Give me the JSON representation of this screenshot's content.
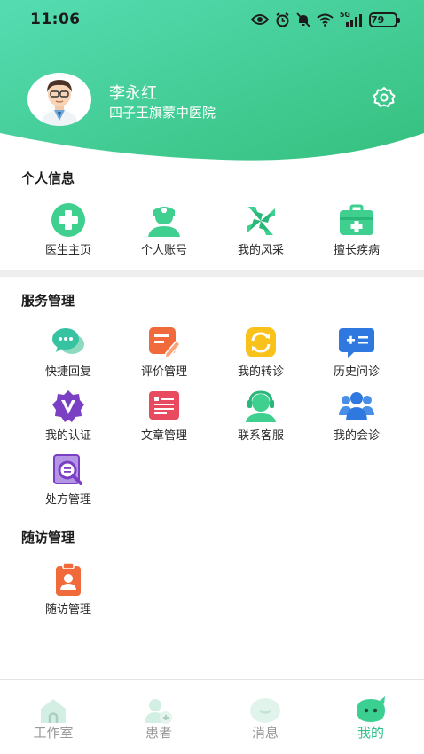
{
  "status_bar": {
    "time": "11:06",
    "battery": "79",
    "network": "5G"
  },
  "profile": {
    "name": "李永红",
    "hospital": "四子王旗蒙中医院",
    "settings_icon": "gear-icon"
  },
  "personal_info": {
    "title": "个人信息",
    "items": [
      {
        "label": "医生主页",
        "icon": "medical-cross-icon"
      },
      {
        "label": "个人账号",
        "icon": "nurse-icon"
      },
      {
        "label": "我的风采",
        "icon": "pinwheel-icon"
      },
      {
        "label": "擅长疾病",
        "icon": "medical-kit-icon"
      }
    ]
  },
  "service_management": {
    "title": "服务管理",
    "items": [
      {
        "label": "快捷回复",
        "icon": "chat-bubbles-icon"
      },
      {
        "label": "评价管理",
        "icon": "edit-note-icon"
      },
      {
        "label": "我的转诊",
        "icon": "transfer-icon"
      },
      {
        "label": "历史问诊",
        "icon": "calculator-history-icon"
      },
      {
        "label": "我的认证",
        "icon": "verified-badge-icon"
      },
      {
        "label": "文章管理",
        "icon": "article-icon"
      },
      {
        "label": "联系客服",
        "icon": "customer-service-icon"
      },
      {
        "label": "我的会诊",
        "icon": "group-icon"
      },
      {
        "label": "处方管理",
        "icon": "prescription-search-icon"
      }
    ]
  },
  "follow_up": {
    "title": "随访管理",
    "items": [
      {
        "label": "随访管理",
        "icon": "clipboard-user-icon"
      }
    ]
  },
  "tab_bar": {
    "tabs": [
      {
        "label": "工作室",
        "icon": "studio-icon",
        "active": false
      },
      {
        "label": "患者",
        "icon": "patient-icon",
        "active": false
      },
      {
        "label": "消息",
        "icon": "message-icon",
        "active": false
      },
      {
        "label": "我的",
        "icon": "me-icon",
        "active": true
      }
    ]
  },
  "colors": {
    "brand_green": "#3ccf92",
    "header_gradient_start": "#52dbaf",
    "header_gradient_end": "#37c282",
    "active_tab": "#2fc18a"
  }
}
